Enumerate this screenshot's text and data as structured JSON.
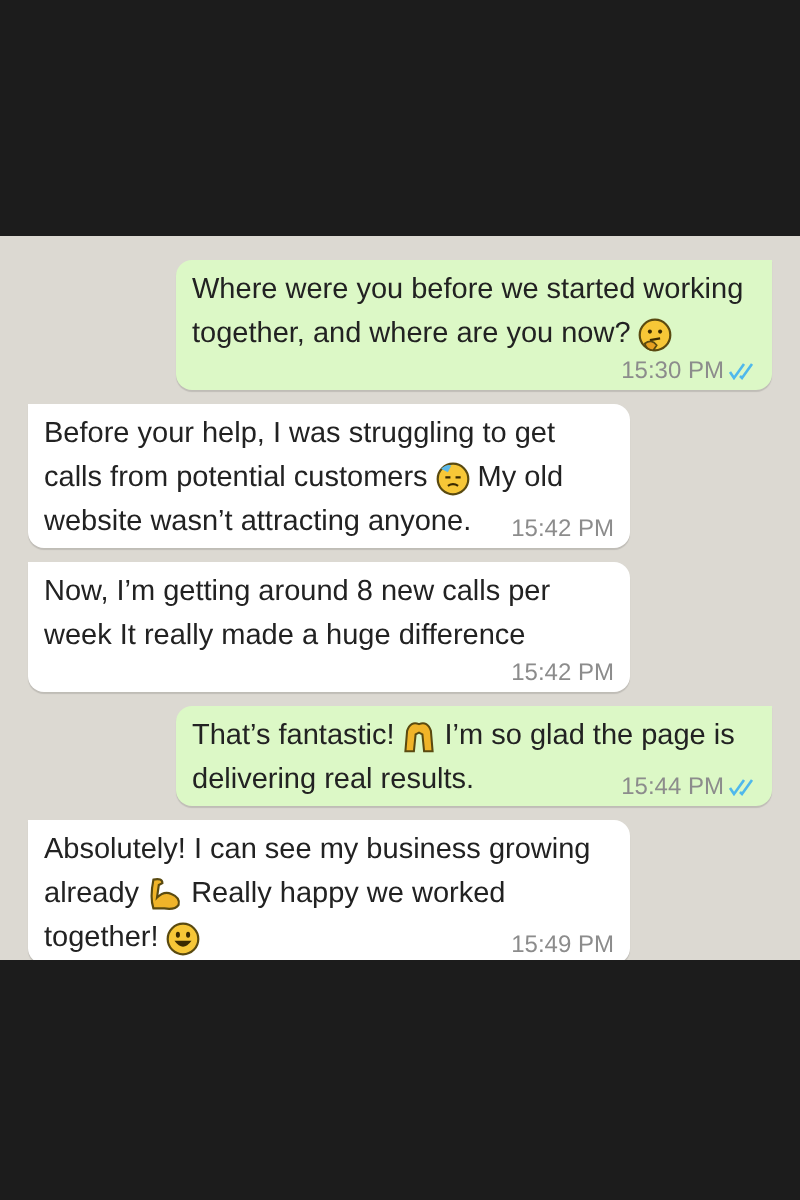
{
  "messages": [
    {
      "kind": "sent",
      "time": "15:30 PM",
      "read": true,
      "lines": [
        [
          {
            "kind": "text",
            "text": "Where were you before we started working"
          }
        ],
        [
          {
            "kind": "text",
            "text": "together, and where are you now?"
          },
          {
            "kind": "thinking"
          }
        ]
      ]
    },
    {
      "kind": "received",
      "time": "15:42 PM",
      "lines": [
        [
          {
            "kind": "text",
            "text": "Before your help, I was struggling to get"
          }
        ],
        [
          {
            "kind": "text",
            "text": "calls from potential customers"
          },
          {
            "kind": "sad"
          },
          {
            "kind": "text",
            "text": "My old"
          }
        ],
        [
          {
            "kind": "text",
            "text": "website wasn’t attracting anyone."
          }
        ]
      ]
    },
    {
      "kind": "received",
      "time": "15:42 PM",
      "lines": [
        [
          {
            "kind": "text",
            "text": "Now, I’m getting around 8 new calls per"
          }
        ],
        [
          {
            "kind": "text",
            "text": "week It really made a huge difference"
          }
        ]
      ]
    },
    {
      "kind": "sent",
      "time": "15:44 PM",
      "read": true,
      "lines": [
        [
          {
            "kind": "text",
            "text": "That’s fantastic!"
          },
          {
            "kind": "hands"
          },
          {
            "kind": "text",
            "text": "I’m so glad the page is"
          }
        ],
        [
          {
            "kind": "text",
            "text": "delivering real results."
          }
        ]
      ]
    },
    {
      "kind": "received",
      "time": "15:49 PM",
      "lines": [
        [
          {
            "kind": "text",
            "text": "Absolutely! I can see my business growing"
          }
        ],
        [
          {
            "kind": "text",
            "text": "already"
          },
          {
            "kind": "muscle"
          },
          {
            "kind": "text",
            "text": "Really happy we worked"
          }
        ],
        [
          {
            "kind": "text",
            "text": "together!"
          },
          {
            "kind": "grin"
          }
        ]
      ]
    }
  ]
}
